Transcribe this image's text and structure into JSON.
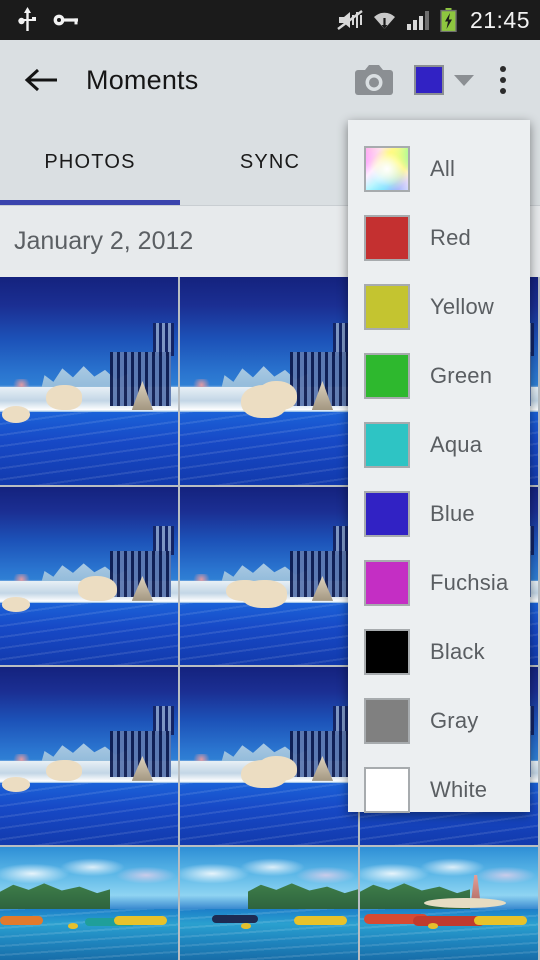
{
  "statusbar": {
    "time": "21:45",
    "icons": [
      "usb-icon",
      "vpn-key-icon",
      "mute-vibrate-icon",
      "wifi-icon",
      "cellular-signal-icon",
      "battery-charging-icon"
    ]
  },
  "appbar": {
    "back_label": "back-arrow",
    "title": "Moments",
    "camera_label": "camera-icon",
    "color_filter_value": "Blue",
    "color_filter_hex": "#3122c4",
    "overflow_label": "more-options"
  },
  "tabs": [
    {
      "label": "PHOTOS",
      "selected": true
    },
    {
      "label": "SYNC",
      "selected": false
    }
  ],
  "accent_hex": "#3b44ad",
  "date_header": "January 2, 2012",
  "color_menu": {
    "items": [
      {
        "label": "All",
        "hex": "rainbow"
      },
      {
        "label": "Red",
        "hex": "#c43030"
      },
      {
        "label": "Yellow",
        "hex": "#c4c430"
      },
      {
        "label": "Green",
        "hex": "#2eb82e"
      },
      {
        "label": "Aqua",
        "hex": "#2ec4c4"
      },
      {
        "label": "Blue",
        "hex": "#3122c4"
      },
      {
        "label": "Fuchsia",
        "hex": "#c42ec4"
      },
      {
        "label": "Black",
        "hex": "#000000"
      },
      {
        "label": "Gray",
        "hex": "#808080"
      },
      {
        "label": "White",
        "hex": "#ffffff"
      }
    ]
  },
  "photo_grid": {
    "columns": 3,
    "tiles": [
      {
        "name": "photo-polar-bears-1",
        "scene": "polar-bear"
      },
      {
        "name": "photo-polar-bears-2",
        "scene": "polar-bear"
      },
      {
        "name": "photo-polar-bears-3",
        "scene": "polar-bear"
      },
      {
        "name": "photo-polar-bears-4",
        "scene": "polar-bear"
      },
      {
        "name": "photo-polar-bears-5",
        "scene": "polar-bear"
      },
      {
        "name": "photo-polar-bears-6",
        "scene": "polar-bear"
      },
      {
        "name": "photo-polar-bears-7",
        "scene": "polar-bear"
      },
      {
        "name": "photo-polar-bears-8",
        "scene": "polar-bear"
      },
      {
        "name": "photo-polar-bears-9",
        "scene": "polar-bear"
      },
      {
        "name": "photo-island-boats-1",
        "scene": "island"
      },
      {
        "name": "photo-island-boats-2",
        "scene": "island"
      },
      {
        "name": "photo-island-boats-3",
        "scene": "island"
      }
    ]
  }
}
